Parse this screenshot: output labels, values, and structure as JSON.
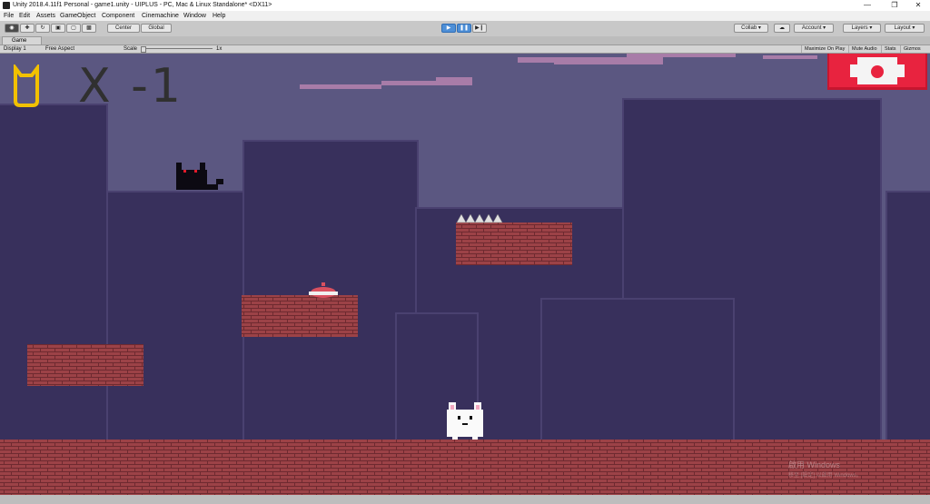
{
  "window": {
    "title": "Unity 2018.4.11f1 Personal - game1.unity - UIPLUS - PC, Mac & Linux Standalone* <DX11>"
  },
  "menu": [
    "File",
    "Edit",
    "Assets",
    "GameObject",
    "Component",
    "Cinemachine",
    "Window",
    "Help"
  ],
  "toolbar": {
    "center_label": "Center",
    "global_label": "Global",
    "collab_label": "Collab",
    "account_label": "Account",
    "layers_label": "Layers",
    "layout_label": "Layout"
  },
  "game_tab": {
    "label": "Game"
  },
  "game_options": {
    "display": "Display 1",
    "aspect": "Free Aspect",
    "scale_label": "Scale",
    "scale_value": "1x",
    "maximize": "Maximize On Play",
    "mute": "Mute Audio",
    "stats": "Stats",
    "gizmos": "Gizmos"
  },
  "hud": {
    "lives": "X -1"
  },
  "watermark": {
    "line1": "啟用 Windows",
    "line2": "移至 [設定] 以啟用 Windows。"
  },
  "colors": {
    "sky": "#5b5781",
    "building": "#38305c",
    "building_edge": "#4a4170",
    "brick": "#9c4247",
    "brick_line": "#6e2a30",
    "cloud": "#a87ca8",
    "hud_cat": "#f2c100",
    "pause_button": "#e8233f"
  }
}
